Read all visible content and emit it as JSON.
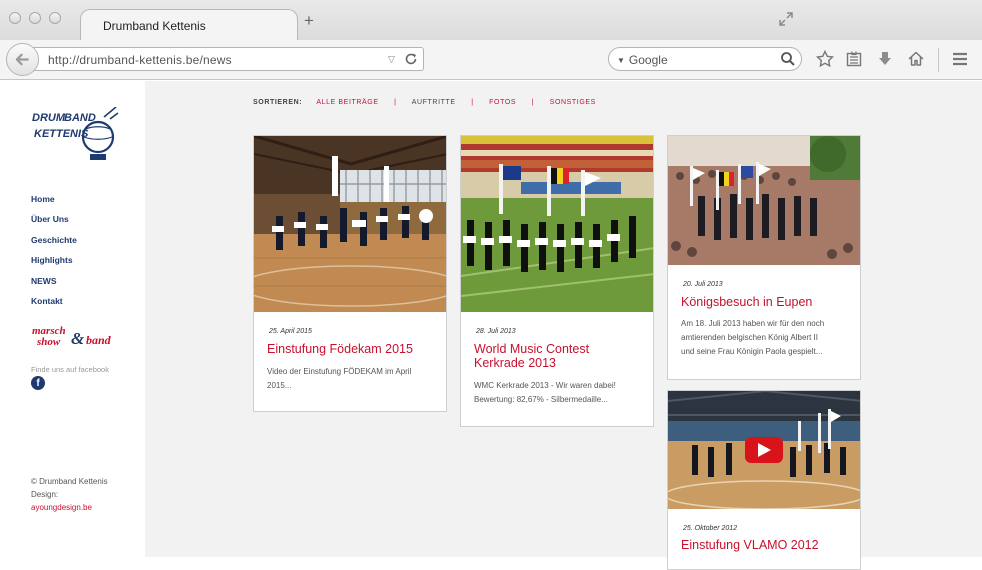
{
  "browser": {
    "tab_title": "Drumband Kettenis",
    "new_tab_label": "+",
    "url": "http://drumband-kettenis.be/news",
    "search_engine": "Google"
  },
  "sidebar": {
    "logo_text": "DRUM BAND KETTENIS",
    "menu": [
      "Home",
      "Über Uns",
      "Geschichte",
      "Highlights",
      "NEWS",
      "Kontakt"
    ],
    "marsch_logo_text": "marsch show & band",
    "facebook_text": "Finde uns auf facebook",
    "facebook_letter": "f",
    "credits": {
      "copyright": "© Drumband Kettenis",
      "design_label": "Design:",
      "design_link": "ayoungdesign.be"
    }
  },
  "filters": {
    "label": "SORTIEREN:",
    "items": [
      "ALLE BEITRÄGE",
      "AUFTRITTE",
      "FOTOS",
      "SONSTIGES"
    ],
    "separator": "|"
  },
  "posts": [
    {
      "date": "25. April 2015",
      "title": "Einstufung Födekam 2015",
      "excerpt": [
        "Video der Einstufung FÖDEKAM im April",
        "2015..."
      ]
    },
    {
      "date": "28. Juli 2013",
      "title": [
        "World Music Contest",
        "Kerkrade 2013"
      ],
      "excerpt": [
        "WMC Kerkrade 2013 - Wir waren dabei!",
        "Bewertung: 82,67% - Silbermedaille..."
      ]
    },
    {
      "date": "20. Juli 2013",
      "title": "Königsbesuch in Eupen",
      "excerpt": [
        "Am 18. Juli 2013 haben wir für den noch",
        "amtierenden belgischen König Albert II",
        "und seine Frau Königin Paola gespielt..."
      ]
    },
    {
      "date": "25. Oktober 2012",
      "title": "Einstufung VLAMO 2012"
    }
  ],
  "colors": {
    "accent": "#c8102e",
    "navy": "#1f3a6e",
    "page_bg": "#f2f2f2"
  }
}
